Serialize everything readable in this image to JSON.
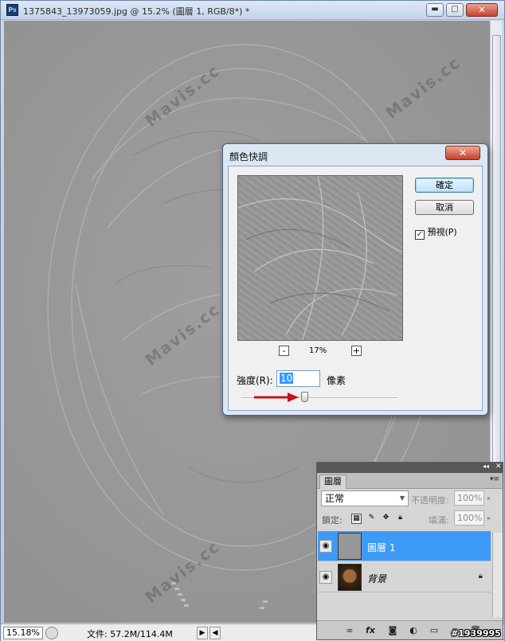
{
  "window": {
    "title": "1375843_13973059.jpg @ 15.2% (圖層 1, RGB/8*) *",
    "app_icon": "Ps",
    "minimize_glyph": "▬",
    "maximize_glyph": "□",
    "close_glyph": "✕"
  },
  "status": {
    "zoom": "15.18%",
    "doc_size": "文件: 57.2M/114.4M",
    "arrow_right": "▶",
    "arrow_left": "◀"
  },
  "watermark": "Mavis.cc",
  "image_id": "#1939995",
  "dialog": {
    "title": "顏色快調",
    "close_glyph": "✕",
    "ok_label": "確定",
    "cancel_label": "取消",
    "preview_label": "預視(P)",
    "preview_checked": true,
    "zoom_out": "-",
    "zoom_in": "+",
    "zoom_percent": "17%",
    "strength_label": "強度(R):",
    "strength_value": "10",
    "unit_label": "像素"
  },
  "layers_panel": {
    "tab_label": "圖層",
    "collapse_glyph": "◂◂",
    "close_glyph": "✕",
    "menu_glyph": "▾≡",
    "blend_mode": "正常",
    "opacity_label": "不透明度:",
    "opacity_value": "100%",
    "lock_label": "鎖定:",
    "fill_label": "填滿:",
    "fill_value": "100%",
    "layers": [
      {
        "name": "圖層 1",
        "selected": true,
        "visible": true,
        "locked": false
      },
      {
        "name": "背景",
        "selected": false,
        "visible": true,
        "locked": true
      }
    ],
    "bottom_icons": [
      "link-icon",
      "fx-icon",
      "mask-icon",
      "adjustment-icon",
      "group-icon",
      "new-layer-icon",
      "trash-icon"
    ],
    "fx_text": "fx"
  },
  "colors": {
    "selection_blue": "#3d9bf7",
    "arrow_red": "#c0151c"
  }
}
